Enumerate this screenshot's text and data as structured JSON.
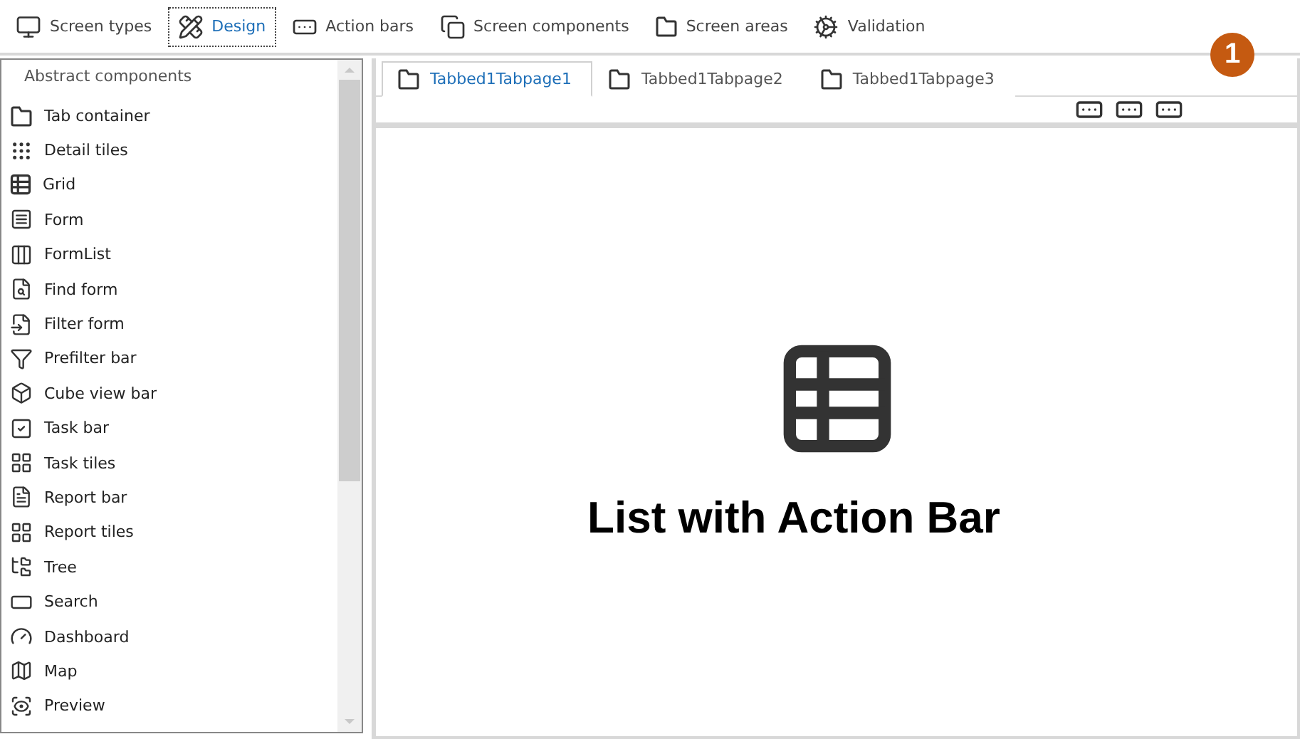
{
  "toolbar": [
    {
      "label": "Screen types",
      "selected": false
    },
    {
      "label": "Design",
      "selected": true
    },
    {
      "label": "Action bars",
      "selected": false
    },
    {
      "label": "Screen components",
      "selected": false
    },
    {
      "label": "Screen areas",
      "selected": false
    },
    {
      "label": "Validation",
      "selected": false
    }
  ],
  "panel": {
    "title": "Abstract components",
    "items": [
      "Tab container",
      "Detail tiles",
      "Grid",
      "Form",
      "FormList",
      "Find form",
      "Filter form",
      "Prefilter bar",
      "Cube view bar",
      "Task bar",
      "Task tiles",
      "Report bar",
      "Report tiles",
      "Tree",
      "Search",
      "Dashboard",
      "Map",
      "Preview"
    ]
  },
  "tabs": [
    {
      "label": "Tabbed1Tabpage1",
      "selected": true
    },
    {
      "label": "Tabbed1Tabpage2",
      "selected": false
    },
    {
      "label": "Tabbed1Tabpage3",
      "selected": false
    }
  ],
  "badge": "1",
  "caption": "List with Action Bar"
}
